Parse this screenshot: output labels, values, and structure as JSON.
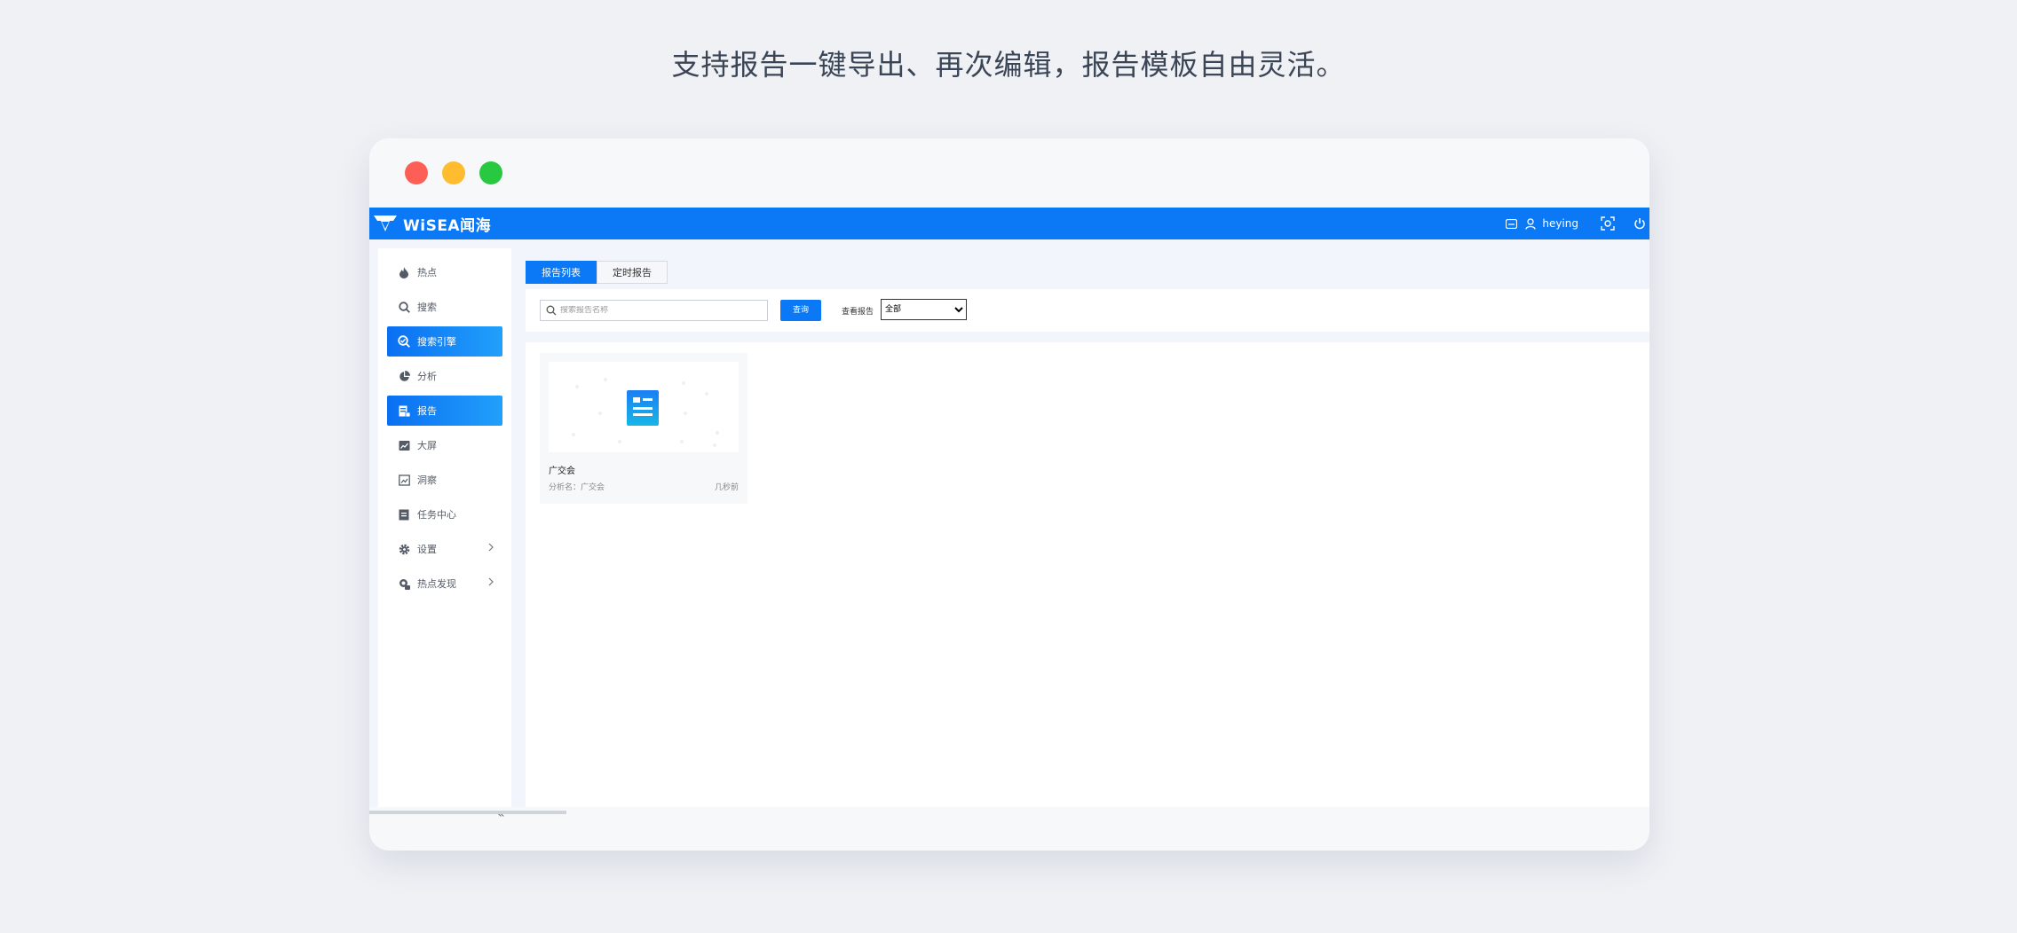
{
  "headline": "支持报告一键导出、再次编辑，报告模板自由灵活。",
  "app": {
    "logo_text": "WiSEA闻海",
    "user_name": "heying"
  },
  "sidebar": {
    "items": [
      {
        "label": "热点",
        "icon": "flame-icon"
      },
      {
        "label": "搜索",
        "icon": "search-icon"
      },
      {
        "label": "搜索引擎",
        "icon": "search-engine-icon"
      },
      {
        "label": "分析",
        "icon": "pie-chart-icon"
      },
      {
        "label": "报告",
        "icon": "report-icon"
      },
      {
        "label": "大屏",
        "icon": "big-screen-icon"
      },
      {
        "label": "洞察",
        "icon": "insight-icon"
      },
      {
        "label": "任务中心",
        "icon": "task-icon"
      },
      {
        "label": "设置",
        "icon": "gear-icon"
      },
      {
        "label": "热点发现",
        "icon": "discover-icon"
      }
    ],
    "collapse_label": "«"
  },
  "tabs": [
    {
      "label": "报告列表"
    },
    {
      "label": "定时报告"
    }
  ],
  "filters": {
    "search_placeholder": "搜索报告名称",
    "query_button": "查询",
    "view_label": "查看报告",
    "view_options": [
      "全部"
    ],
    "view_selected": "全部"
  },
  "reports": [
    {
      "title": "广交会",
      "meta": "分析名：广交会",
      "time": "几秒前"
    }
  ],
  "colors": {
    "brand": "#0b78f5",
    "active_gradient_end": "#21a0fb",
    "traffic_red": "#fd5f57",
    "traffic_yellow": "#febc2e",
    "traffic_green": "#28c840"
  }
}
